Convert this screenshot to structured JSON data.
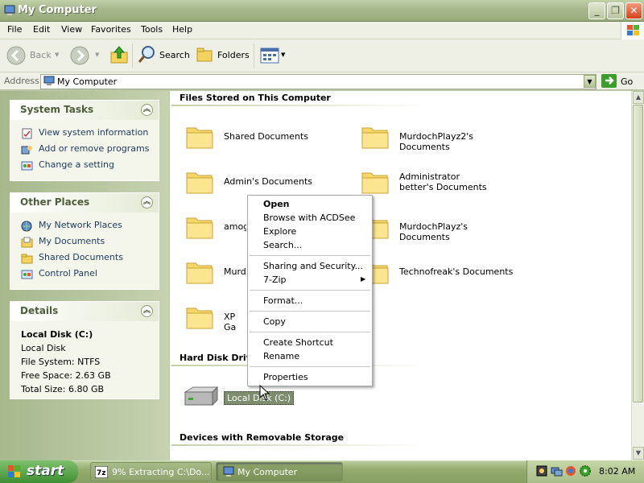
{
  "window": {
    "title": "My Computer"
  },
  "menu": [
    "File",
    "Edit",
    "View",
    "Favorites",
    "Tools",
    "Help"
  ],
  "toolbar": {
    "back": "Back",
    "search": "Search",
    "folders": "Folders"
  },
  "address": {
    "label": "Address",
    "value": "My Computer",
    "go": "Go"
  },
  "side": {
    "system_tasks": {
      "title": "System Tasks",
      "items": [
        "View system information",
        "Add or remove programs",
        "Change a setting"
      ]
    },
    "other_places": {
      "title": "Other Places",
      "items": [
        "My Network Places",
        "My Documents",
        "Shared Documents",
        "Control Panel"
      ]
    },
    "details": {
      "title": "Details",
      "name": "Local Disk (C:)",
      "type": "Local Disk",
      "fs": "File System: NTFS",
      "free": "Free Space: 2.63 GB",
      "total": "Total Size: 6.80 GB"
    }
  },
  "content": {
    "files_header": "Files Stored on This Computer",
    "folders": [
      "Shared Documents",
      "MurdochPlayz2's Documents",
      "Admin's Documents",
      "Administrator better's Documents",
      "amogu",
      "MurdochPlayz's Documents",
      "Murdo",
      "Technofreak's Documents",
      "XP Ga"
    ],
    "hdd_header": "Hard Disk Drive",
    "drive": "Local Disk (C:)",
    "removable_header": "Devices with Removable Storage"
  },
  "context_menu": {
    "open": "Open",
    "items": [
      "Browse with ACDSee",
      "Explore",
      "Search...",
      "Sharing and Security...",
      "7-Zip",
      "Format...",
      "Copy",
      "Create Shortcut",
      "Rename",
      "Properties"
    ]
  },
  "taskbar": {
    "start": "start",
    "tasks": [
      "9% Extracting C:\\Do...",
      "My Computer"
    ],
    "clock": "8:02 AM"
  },
  "colors": {
    "accent": "#4e5e3a",
    "selection": "#3169c6"
  }
}
